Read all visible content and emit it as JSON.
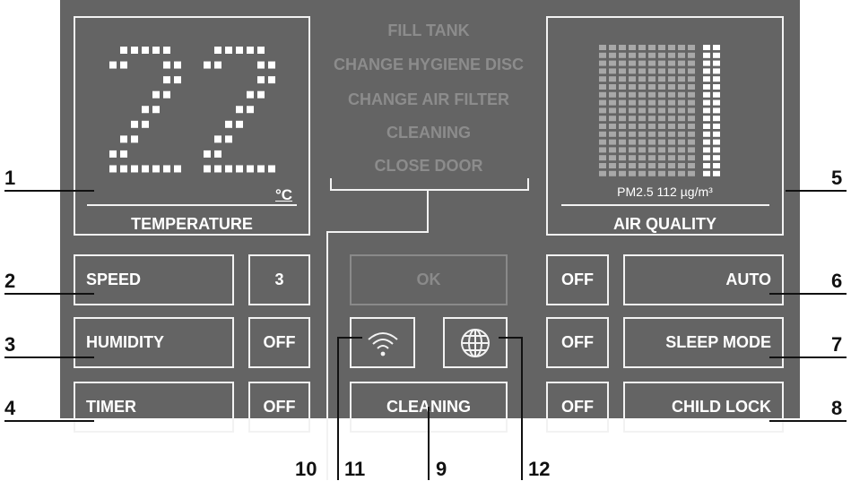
{
  "temperature": {
    "value": "22",
    "unit": "°C",
    "label": "TEMPERATURE"
  },
  "messages": [
    "FILL TANK",
    "CHANGE HYGIENE DISC",
    "CHANGE AIR FILTER",
    "CLEANING",
    "CLOSE DOOR"
  ],
  "air_quality": {
    "reading": "PM2.5 112 µg/m³",
    "label": "AIR QUALITY",
    "level_fraction": 0.2
  },
  "left_controls": [
    {
      "label": "SPEED",
      "value": "3"
    },
    {
      "label": "HUMIDITY",
      "value": "OFF"
    },
    {
      "label": "TIMER",
      "value": "OFF"
    }
  ],
  "center_controls": {
    "ok_label": "OK",
    "cleaning_label": "CLEANING",
    "wifi_icon": "wifi-icon",
    "globe_icon": "globe-icon"
  },
  "right_controls": [
    {
      "state": "OFF",
      "label": "AUTO"
    },
    {
      "state": "OFF",
      "label": "SLEEP MODE"
    },
    {
      "state": "OFF",
      "label": "CHILD LOCK"
    }
  ],
  "callouts": {
    "n1": "1",
    "n2": "2",
    "n3": "3",
    "n4": "4",
    "n5": "5",
    "n6": "6",
    "n7": "7",
    "n8": "8",
    "n9": "9",
    "n10": "10",
    "n11": "11",
    "n12": "12"
  },
  "colors": {
    "panel": "#646464",
    "border": "#f2f2f2",
    "text": "#ffffff",
    "dim": "#8c8c8c"
  }
}
